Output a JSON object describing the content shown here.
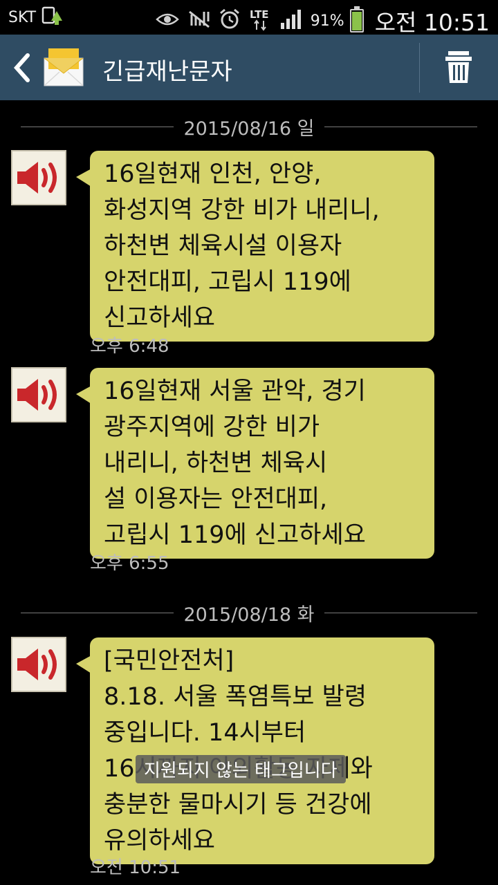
{
  "status_bar": {
    "carrier": "SKT",
    "network": "LTE",
    "battery_percent": "91%",
    "battery_level": 0.91,
    "time": "오전 10:51",
    "icons": [
      "sim-upload-icon",
      "eye-icon",
      "signal-off-icon",
      "alarm-icon",
      "lte-data-icon",
      "signal-bars-icon",
      "battery-icon"
    ]
  },
  "header": {
    "title": "긴급재난문자",
    "back_icon": "chevron-left-icon",
    "app_icon": "envelope-icon",
    "delete_icon": "trash-icon"
  },
  "conversation": {
    "dates": [
      "2015/08/16 일",
      "2015/08/18 화"
    ],
    "messages": [
      {
        "sender_icon": "speaker-icon",
        "lines": [
          "16일현재 인천, 안양,",
          "화성지역 강한 비가 내리니,",
          "하천변 체육시설 이용자",
          "안전대피, 고립시 119에",
          "신고하세요"
        ],
        "time": "오후 6:48"
      },
      {
        "sender_icon": "speaker-icon",
        "lines": [
          "16일현재 서울 관악, 경기",
          "광주지역에 강한 비가",
          "내리니, 하천변 체육시",
          "설 이용자는 안전대피,",
          "고립시 119에 신고하세요"
        ],
        "time": "오후 6:55"
      },
      {
        "sender_icon": "speaker-icon",
        "lines": [
          "[국민안전처]",
          "8.18. 서울 폭염특보 발령",
          "중입니다. 14시부터",
          "16시까지 야외활동 자제와",
          "충분한 물마시기 등 건강에",
          "유의하세요"
        ],
        "time": "오전 10:51"
      }
    ]
  },
  "toast": "지원되지 않는 태그입니다",
  "colors": {
    "header_bg": "#2f4c63",
    "bubble_bg": "#d6d46c",
    "background": "#000000",
    "battery_fill": "#8bc24a"
  }
}
